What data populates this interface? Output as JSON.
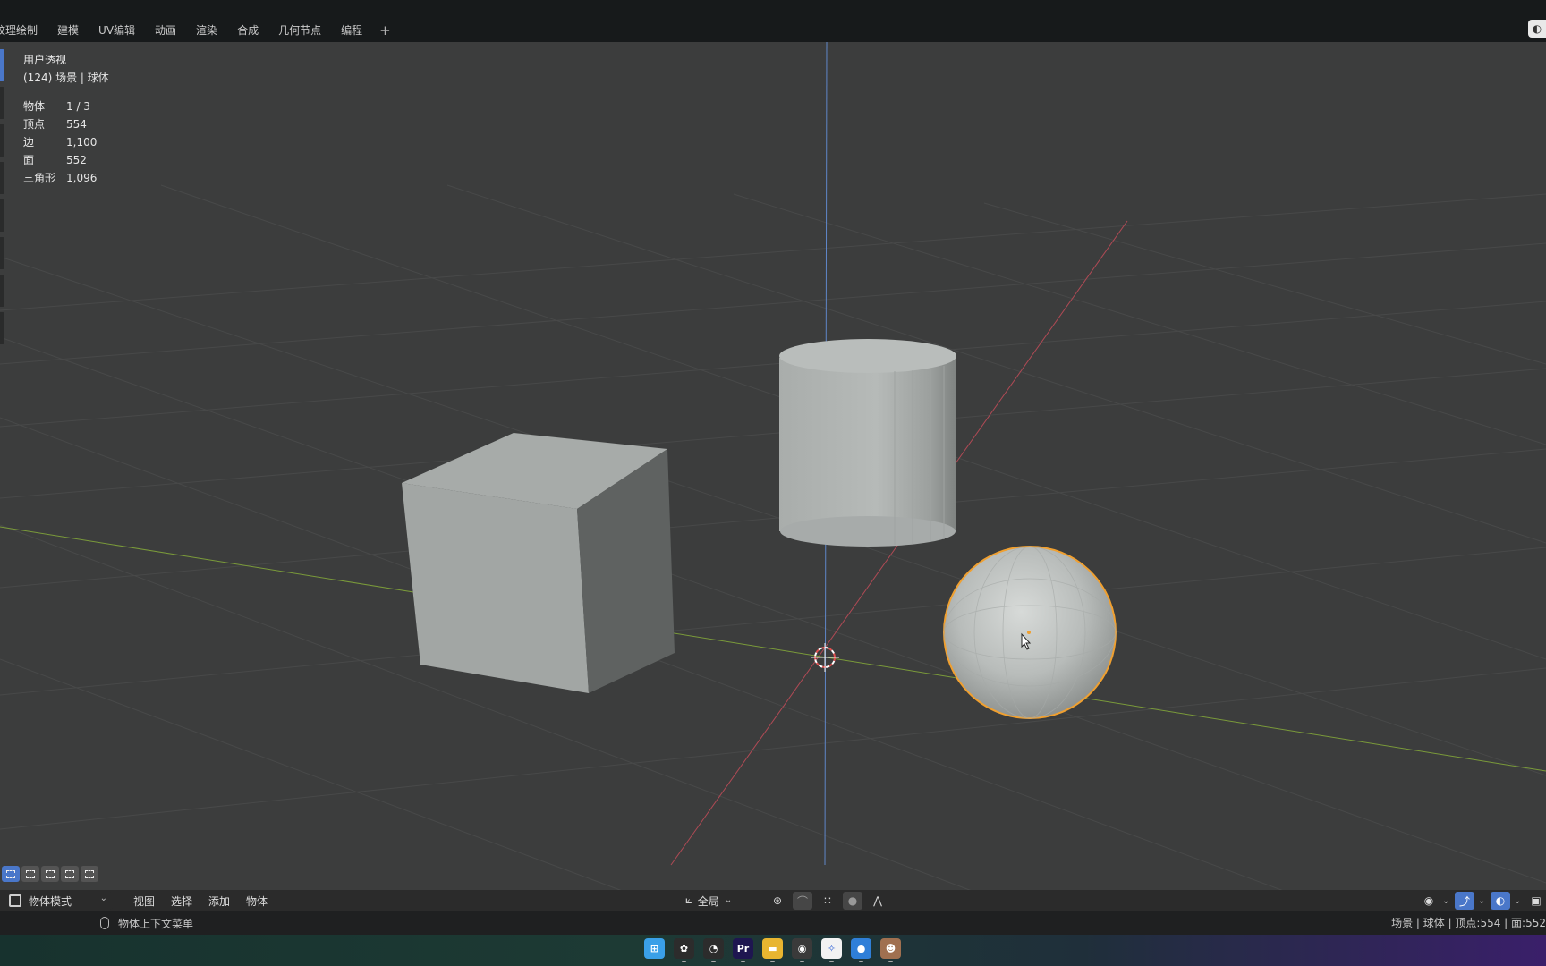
{
  "topbar": {
    "tabs": [
      "纹理绘制",
      "建模",
      "UV编辑",
      "动画",
      "渲染",
      "合成",
      "几何节点",
      "编程"
    ],
    "add_label": "+"
  },
  "viewport": {
    "overlay_title": "用户透视",
    "overlay_subtitle": "(124) 场景 | 球体",
    "stats": [
      {
        "key": "物体",
        "value": "1 / 3"
      },
      {
        "key": "顶点",
        "value": "554"
      },
      {
        "key": "边",
        "value": "1,100"
      },
      {
        "key": "面",
        "value": "552"
      },
      {
        "key": "三角形",
        "value": "1,096"
      }
    ],
    "objects": [
      {
        "name": "cube",
        "selected": false
      },
      {
        "name": "cylinder",
        "selected": false
      },
      {
        "name": "sphere",
        "selected": true
      }
    ],
    "colors": {
      "background": "#3c3d3d",
      "grid": "#4a4b4b",
      "x_axis": "#b04a55",
      "y_axis": "#7a9a3a",
      "z_axis": "#5f86c8",
      "selection": "#f0a030"
    }
  },
  "header": {
    "mode": "物体模式",
    "menus": [
      "视图",
      "选择",
      "添加",
      "物体"
    ],
    "orientation": "全局"
  },
  "status": {
    "left_text": "物体上下文菜单",
    "right_text": "场景 | 球体 | 顶点:554 | 面:552"
  },
  "taskbar": {
    "icons": [
      {
        "name": "windows-start-icon",
        "label": "⊞",
        "color": "#3aa0e8"
      },
      {
        "name": "app-icon-1",
        "label": "✿",
        "color": "#2c2c2c"
      },
      {
        "name": "app-icon-2",
        "label": "◔",
        "color": "#2c2c2c"
      },
      {
        "name": "premiere-icon",
        "label": "Pr",
        "color": "#1e1650"
      },
      {
        "name": "file-explorer-icon",
        "label": "▬",
        "color": "#e8b530"
      },
      {
        "name": "blender-icon",
        "label": "◉",
        "color": "#3a3a3a"
      },
      {
        "name": "app-icon-3",
        "label": "✧",
        "color": "#f2f2f2"
      },
      {
        "name": "chrome-icon",
        "label": "●",
        "color": "#2f7fd8"
      },
      {
        "name": "app-icon-4",
        "label": "☻",
        "color": "#a07050"
      }
    ]
  }
}
